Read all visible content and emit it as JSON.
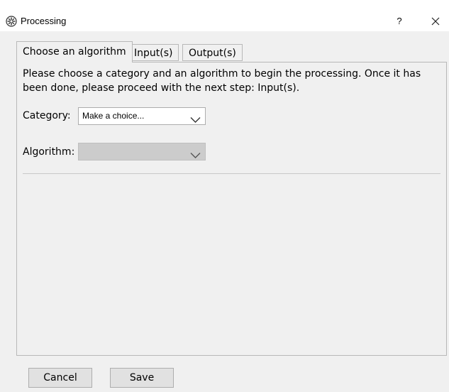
{
  "window": {
    "title": "Processing",
    "help_label": "?",
    "icons": {
      "app": "processing-gear-icon",
      "close": "close-icon"
    }
  },
  "tabs": [
    {
      "label": "Choose an algorithm",
      "active": true
    },
    {
      "label": "Input(s)",
      "active": false
    },
    {
      "label": "Output(s)",
      "active": false
    }
  ],
  "panel": {
    "instructions": "Please choose a category and an algorithm to begin the processing. Once it has been done, please proceed with the next step: Input(s).",
    "category": {
      "label": "Category:",
      "value": "Make a choice...",
      "enabled": true
    },
    "algorithm": {
      "label": "Algorithm:",
      "value": "",
      "enabled": false
    }
  },
  "buttons": {
    "cancel": "Cancel",
    "save": "Save"
  },
  "colors": {
    "background": "#f0f0f0",
    "titlebar": "#ffffff",
    "disabled_combo": "#cccccc",
    "button": "#e1e1e1"
  }
}
